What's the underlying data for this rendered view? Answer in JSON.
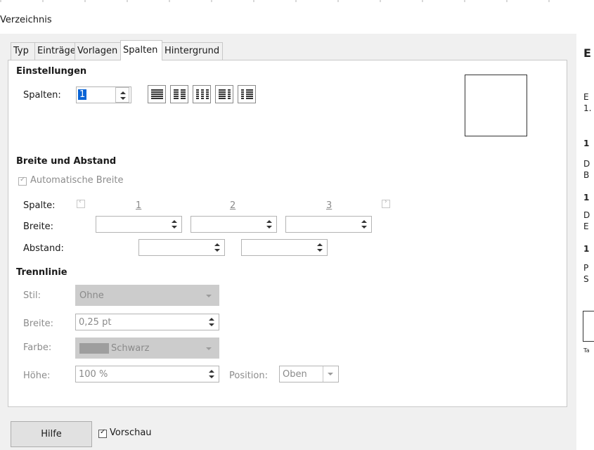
{
  "dialog": {
    "title": "Verzeichnis",
    "tabs": [
      {
        "label": "Typ",
        "active": false
      },
      {
        "label": "Einträge",
        "active": false
      },
      {
        "label": "Vorlagen",
        "active": false
      },
      {
        "label": "Spalten",
        "active": true
      },
      {
        "label": "Hintergrund",
        "active": false
      }
    ]
  },
  "settings": {
    "heading": "Einstellungen",
    "columns_label": "Spalten:",
    "columns_value": "1",
    "presets": [
      "one-column-icon",
      "two-columns-icon",
      "three-columns-icon",
      "two-columns-left-wide-icon",
      "two-columns-right-wide-icon"
    ]
  },
  "width_spacing": {
    "heading": "Breite und Abstand",
    "auto_width_label": "Automatische Breite",
    "auto_width_checked": true,
    "column_label": "Spalte:",
    "column_numbers": [
      "1",
      "2",
      "3"
    ],
    "width_label": "Breite:",
    "spacing_label": "Abstand:"
  },
  "separator": {
    "heading": "Trennlinie",
    "style_label": "Stil:",
    "style_value": "Ohne",
    "width_label": "Breite:",
    "width_value": "0,25 pt",
    "color_label": "Farbe:",
    "color_value": "Schwarz",
    "color_swatch": "#9e9e9e",
    "height_label": "Höhe:",
    "height_value": "100 %",
    "position_label": "Position:",
    "position_value": "Oben"
  },
  "footer": {
    "help_label": "Hilfe",
    "preview_label": "Vorschau",
    "preview_checked": true
  },
  "background_doc": {
    "fragments": [
      "E",
      "1.",
      "1",
      "D",
      "B",
      "1",
      "D",
      "E",
      "1",
      "P",
      "S",
      "Ta"
    ]
  }
}
